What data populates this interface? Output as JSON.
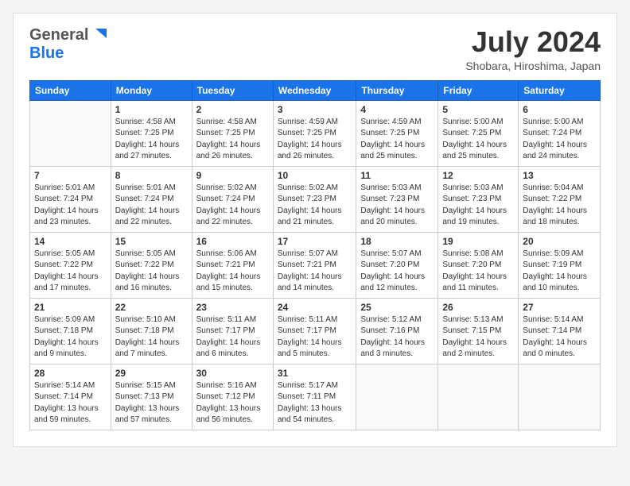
{
  "header": {
    "logo_general": "General",
    "logo_blue": "Blue",
    "month_year": "July 2024",
    "location": "Shobara, Hiroshima, Japan"
  },
  "weekdays": [
    "Sunday",
    "Monday",
    "Tuesday",
    "Wednesday",
    "Thursday",
    "Friday",
    "Saturday"
  ],
  "weeks": [
    [
      {
        "num": "",
        "info": ""
      },
      {
        "num": "1",
        "info": "Sunrise: 4:58 AM\nSunset: 7:25 PM\nDaylight: 14 hours\nand 27 minutes."
      },
      {
        "num": "2",
        "info": "Sunrise: 4:58 AM\nSunset: 7:25 PM\nDaylight: 14 hours\nand 26 minutes."
      },
      {
        "num": "3",
        "info": "Sunrise: 4:59 AM\nSunset: 7:25 PM\nDaylight: 14 hours\nand 26 minutes."
      },
      {
        "num": "4",
        "info": "Sunrise: 4:59 AM\nSunset: 7:25 PM\nDaylight: 14 hours\nand 25 minutes."
      },
      {
        "num": "5",
        "info": "Sunrise: 5:00 AM\nSunset: 7:25 PM\nDaylight: 14 hours\nand 25 minutes."
      },
      {
        "num": "6",
        "info": "Sunrise: 5:00 AM\nSunset: 7:24 PM\nDaylight: 14 hours\nand 24 minutes."
      }
    ],
    [
      {
        "num": "7",
        "info": "Sunrise: 5:01 AM\nSunset: 7:24 PM\nDaylight: 14 hours\nand 23 minutes."
      },
      {
        "num": "8",
        "info": "Sunrise: 5:01 AM\nSunset: 7:24 PM\nDaylight: 14 hours\nand 22 minutes."
      },
      {
        "num": "9",
        "info": "Sunrise: 5:02 AM\nSunset: 7:24 PM\nDaylight: 14 hours\nand 22 minutes."
      },
      {
        "num": "10",
        "info": "Sunrise: 5:02 AM\nSunset: 7:23 PM\nDaylight: 14 hours\nand 21 minutes."
      },
      {
        "num": "11",
        "info": "Sunrise: 5:03 AM\nSunset: 7:23 PM\nDaylight: 14 hours\nand 20 minutes."
      },
      {
        "num": "12",
        "info": "Sunrise: 5:03 AM\nSunset: 7:23 PM\nDaylight: 14 hours\nand 19 minutes."
      },
      {
        "num": "13",
        "info": "Sunrise: 5:04 AM\nSunset: 7:22 PM\nDaylight: 14 hours\nand 18 minutes."
      }
    ],
    [
      {
        "num": "14",
        "info": "Sunrise: 5:05 AM\nSunset: 7:22 PM\nDaylight: 14 hours\nand 17 minutes."
      },
      {
        "num": "15",
        "info": "Sunrise: 5:05 AM\nSunset: 7:22 PM\nDaylight: 14 hours\nand 16 minutes."
      },
      {
        "num": "16",
        "info": "Sunrise: 5:06 AM\nSunset: 7:21 PM\nDaylight: 14 hours\nand 15 minutes."
      },
      {
        "num": "17",
        "info": "Sunrise: 5:07 AM\nSunset: 7:21 PM\nDaylight: 14 hours\nand 14 minutes."
      },
      {
        "num": "18",
        "info": "Sunrise: 5:07 AM\nSunset: 7:20 PM\nDaylight: 14 hours\nand 12 minutes."
      },
      {
        "num": "19",
        "info": "Sunrise: 5:08 AM\nSunset: 7:20 PM\nDaylight: 14 hours\nand 11 minutes."
      },
      {
        "num": "20",
        "info": "Sunrise: 5:09 AM\nSunset: 7:19 PM\nDaylight: 14 hours\nand 10 minutes."
      }
    ],
    [
      {
        "num": "21",
        "info": "Sunrise: 5:09 AM\nSunset: 7:18 PM\nDaylight: 14 hours\nand 9 minutes."
      },
      {
        "num": "22",
        "info": "Sunrise: 5:10 AM\nSunset: 7:18 PM\nDaylight: 14 hours\nand 7 minutes."
      },
      {
        "num": "23",
        "info": "Sunrise: 5:11 AM\nSunset: 7:17 PM\nDaylight: 14 hours\nand 6 minutes."
      },
      {
        "num": "24",
        "info": "Sunrise: 5:11 AM\nSunset: 7:17 PM\nDaylight: 14 hours\nand 5 minutes."
      },
      {
        "num": "25",
        "info": "Sunrise: 5:12 AM\nSunset: 7:16 PM\nDaylight: 14 hours\nand 3 minutes."
      },
      {
        "num": "26",
        "info": "Sunrise: 5:13 AM\nSunset: 7:15 PM\nDaylight: 14 hours\nand 2 minutes."
      },
      {
        "num": "27",
        "info": "Sunrise: 5:14 AM\nSunset: 7:14 PM\nDaylight: 14 hours\nand 0 minutes."
      }
    ],
    [
      {
        "num": "28",
        "info": "Sunrise: 5:14 AM\nSunset: 7:14 PM\nDaylight: 13 hours\nand 59 minutes."
      },
      {
        "num": "29",
        "info": "Sunrise: 5:15 AM\nSunset: 7:13 PM\nDaylight: 13 hours\nand 57 minutes."
      },
      {
        "num": "30",
        "info": "Sunrise: 5:16 AM\nSunset: 7:12 PM\nDaylight: 13 hours\nand 56 minutes."
      },
      {
        "num": "31",
        "info": "Sunrise: 5:17 AM\nSunset: 7:11 PM\nDaylight: 13 hours\nand 54 minutes."
      },
      {
        "num": "",
        "info": ""
      },
      {
        "num": "",
        "info": ""
      },
      {
        "num": "",
        "info": ""
      }
    ]
  ],
  "colors": {
    "header_bg": "#1a73e8",
    "header_text": "#ffffff",
    "border": "#cccccc"
  }
}
